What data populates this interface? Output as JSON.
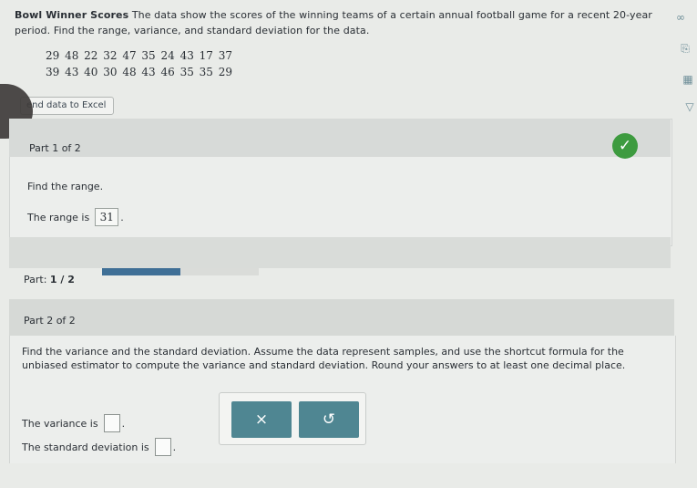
{
  "problem": {
    "title": "Bowl Winner Scores",
    "text_line1": " The data show the scores of the winning teams of a certain annual football game for a recent 20-year",
    "text_line2": "period. Find the range, variance, and standard deviation for the data.",
    "data_row1": "29  48  22  32  47  35  24  43  17  37",
    "data_row2": "39  43  40  30  48  43  46  35  35  29"
  },
  "excel_button": {
    "label": "end data to Excel"
  },
  "side_icons": [
    "infinity-icon",
    "document-icon",
    "calculator-icon",
    "pin-icon"
  ],
  "side_icon_glyphs": {
    "infinity": "∞",
    "doc": "⎘",
    "calc": "▦",
    "pin": "▽"
  },
  "part1": {
    "label": "Part 1 of 2",
    "prompt": "Find the range.",
    "answer_prefix": "The range is",
    "answer_value": "31",
    "answer_suffix": ".",
    "status": "complete"
  },
  "progress": {
    "label_prefix": "Part: ",
    "label_value": "1 / 2",
    "fraction": 0.5,
    "fill_color": "#3f6f96"
  },
  "part2": {
    "label": "Part 2 of 2",
    "instructions": "Find the variance and the standard deviation. Assume the data represent samples, and use the shortcut formula for the unbiased estimator to compute the variance and standard deviation. Round your answers to at least one decimal place.",
    "variance_prefix": "The variance is",
    "variance_suffix": ".",
    "sd_prefix": "The standard deviation is",
    "sd_suffix": "."
  },
  "toolbar": {
    "clear_label": "×",
    "undo_label": "↺"
  },
  "colors": {
    "accent": "#4f8692",
    "check": "#3d9b3f"
  }
}
